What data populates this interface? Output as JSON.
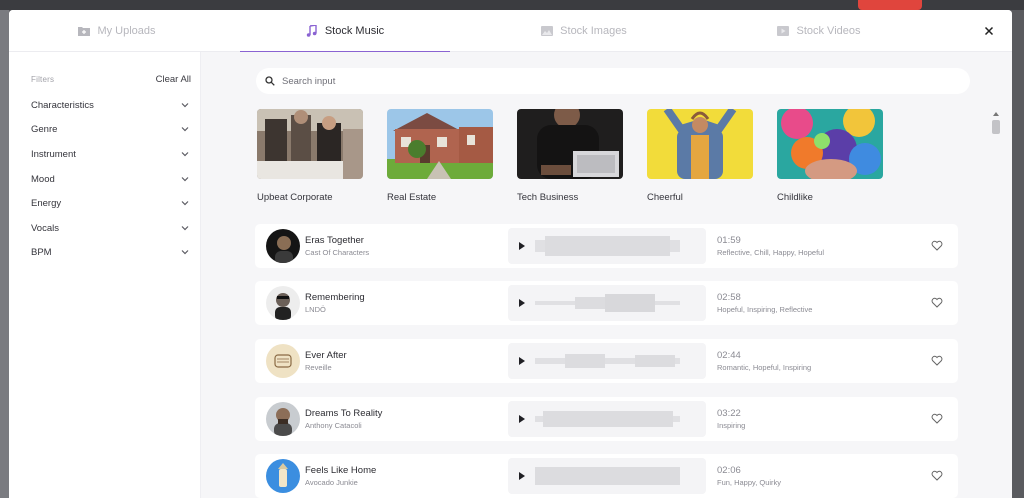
{
  "tabs": [
    {
      "label": "My Uploads",
      "icon": "folder-plus-icon",
      "active": false
    },
    {
      "label": "Stock Music",
      "icon": "music-note-icon",
      "active": true
    },
    {
      "label": "Stock Images",
      "icon": "image-icon",
      "active": false
    },
    {
      "label": "Stock Videos",
      "icon": "video-icon",
      "active": false
    }
  ],
  "filters": {
    "title": "Filters",
    "clear_label": "Clear All",
    "items": [
      "Characteristics",
      "Genre",
      "Instrument",
      "Mood",
      "Energy",
      "Vocals",
      "BPM"
    ]
  },
  "search": {
    "placeholder": "Search input",
    "value": ""
  },
  "categories": [
    {
      "label": "Upbeat Corporate"
    },
    {
      "label": "Real Estate"
    },
    {
      "label": "Tech Business"
    },
    {
      "label": "Cheerful"
    },
    {
      "label": "Childlike"
    }
  ],
  "tracks": [
    {
      "title": "Eras Together",
      "artist": "Cast Of Characters",
      "duration": "01:59",
      "tags": "Reflective, Chill, Happy, Hopeful"
    },
    {
      "title": "Remembering",
      "artist": "LNDÖ",
      "duration": "02:58",
      "tags": "Hopeful, Inspiring, Reflective"
    },
    {
      "title": "Ever After",
      "artist": "Reveille",
      "duration": "02:44",
      "tags": "Romantic, Hopeful, Inspiring"
    },
    {
      "title": "Dreams To Reality",
      "artist": "Anthony Catacoli",
      "duration": "03:22",
      "tags": "Inspiring"
    },
    {
      "title": "Feels Like Home",
      "artist": "Avocado Junkie",
      "duration": "02:06",
      "tags": "Fun, Happy, Quirky"
    }
  ],
  "colors": {
    "accent": "#8a63d2",
    "modal_bg": "#ffffff",
    "content_bg": "#f6f6f8"
  }
}
